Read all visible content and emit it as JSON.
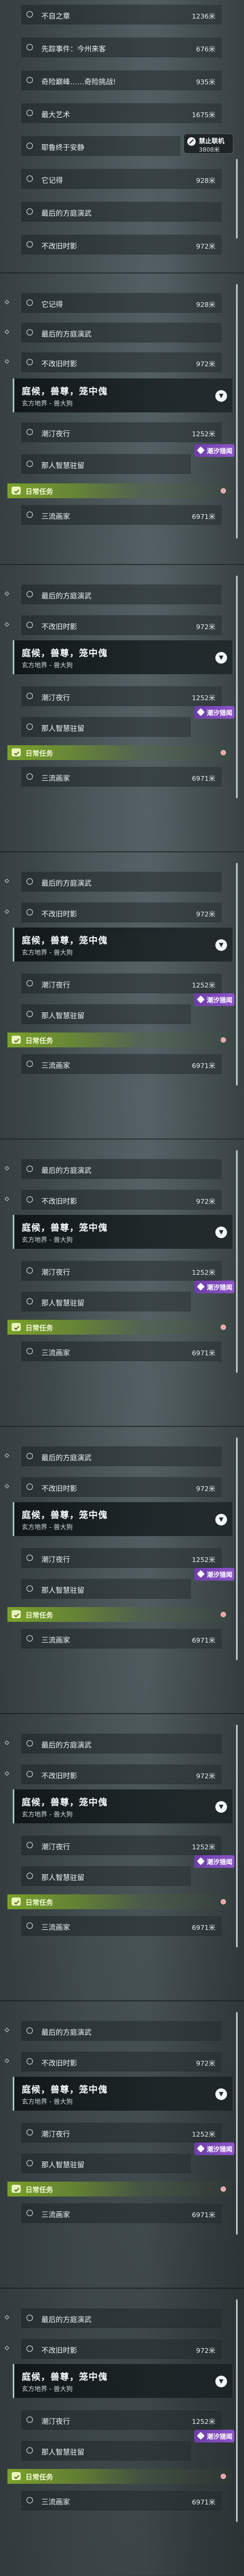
{
  "top_list": {
    "items": [
      {
        "name": "不自之章",
        "distance": "1236米"
      },
      {
        "name": "先踪事件：今州来客",
        "distance": "676米"
      },
      {
        "name": "奇险巅峰……奇险挑战!",
        "distance": "935米"
      },
      {
        "name": "最大艺术",
        "distance": "1675米"
      },
      {
        "name": "耶鲁终于安静",
        "distance": "3808米"
      },
      {
        "name": "它记得",
        "distance": "928米"
      },
      {
        "name": "最后的方庭演武",
        "distance": ""
      },
      {
        "name": "不改旧时影",
        "distance": "972米"
      }
    ],
    "ban_badge": {
      "label": "禁止联机",
      "distance": "3808米",
      "icon": "no-entry-icon"
    }
  },
  "panel_a": {
    "rows_top": [
      {
        "name": "它记得",
        "distance": "928米"
      },
      {
        "name": "最后的方庭演武",
        "distance": ""
      },
      {
        "name": "不改旧时影",
        "distance": "972米"
      }
    ],
    "quest": {
      "title": "庭候，兽尊，笼中傀",
      "subtitle": "玄方地界 - 兽大狗"
    },
    "rows_mid": [
      {
        "name": "潮汀夜行",
        "distance": "1252米"
      },
      {
        "name": "那人智慧驻留",
        "distance": ""
      }
    ],
    "badge": "潮汐猎闻",
    "daily": "日常任务",
    "rows_bottom": [
      {
        "name": "三流画家",
        "distance": "6971米"
      }
    ]
  },
  "panel_b": {
    "rows_top": [
      {
        "name": "最后的方庭演武",
        "distance": ""
      },
      {
        "name": "不改旧时影",
        "distance": "972米"
      }
    ],
    "quest": {
      "title": "庭候，兽尊，笼中傀",
      "subtitle": "玄方地界 - 兽大狗"
    },
    "rows_mid": [
      {
        "name": "潮汀夜行",
        "distance": "1252米"
      },
      {
        "name": "那人智慧驻留",
        "distance": ""
      }
    ],
    "badge": "潮汐猎闻",
    "daily": "日常任务",
    "rows_bottom": [
      {
        "name": "三流画家",
        "distance": "6971米"
      }
    ]
  },
  "colors": {
    "accent_green": "#86b02a",
    "badge_purple": "#7a46b8",
    "quest_border": "#a8c6c8"
  }
}
